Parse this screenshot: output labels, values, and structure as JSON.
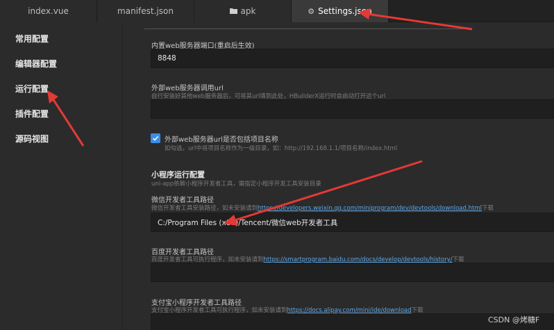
{
  "tabs": [
    {
      "label": "index.vue",
      "icon": ""
    },
    {
      "label": "manifest.json",
      "icon": ""
    },
    {
      "label": "apk",
      "icon": "folder-icon"
    },
    {
      "label": "Settings.json",
      "icon": "gear-icon"
    }
  ],
  "sidebar": {
    "items": [
      {
        "label": "常用配置"
      },
      {
        "label": "编辑器配置"
      },
      {
        "label": "运行配置"
      },
      {
        "label": "插件配置"
      },
      {
        "label": "源码视图"
      }
    ]
  },
  "main": {
    "port": {
      "label": "内置web服务器端口(重启后生效)",
      "value": "8848"
    },
    "external_url": {
      "label": "外部web服务器调用url",
      "desc": "自行安装好其他web服务器后，可将其url填到此处，HBuilderX运行时会启动打开这个url",
      "value": ""
    },
    "include_project": {
      "label": "外部web服务器url是否包括项目名称",
      "desc": "如勾选，url中将项目名称作为一级目录，如：http://192.168.1.1/项目名称/index.html",
      "checked": true
    },
    "miniprogram": {
      "title": "小程序运行配置",
      "desc": "uni-app依赖小程序开发者工具，需指定小程序开发工具安装目录"
    },
    "wechat": {
      "label": "微信开发者工具路径",
      "desc_prefix": "微信开发者工具安装路径，如未安装请到",
      "link": "https://developers.weixin.qq.com/miniprogram/dev/devtools/download.html",
      "desc_suffix": "下载",
      "value": "C:/Program Files (x86)/Tencent/微信web开发者工具"
    },
    "baidu": {
      "label": "百度开发者工具路径",
      "desc_prefix": "百度开发者工具可执行程序，如未安装请到",
      "link": "https://smartprogram.baidu.com/docs/develop/devtools/history/",
      "desc_suffix": "下载",
      "value": ""
    },
    "alipay": {
      "label": "支付宝小程序开发者工具路径",
      "desc_prefix": "支付宝小程序开发者工具可执行程序，如未安装请到",
      "link": "https://docs.alipay.com/mini/ide/download",
      "desc_suffix": "下载",
      "value": ""
    }
  },
  "watermark": "CSDN @烤糖F",
  "colors": {
    "accent": "#3b8ee6",
    "link": "#5fa7e6",
    "annotation": "#e53935"
  }
}
